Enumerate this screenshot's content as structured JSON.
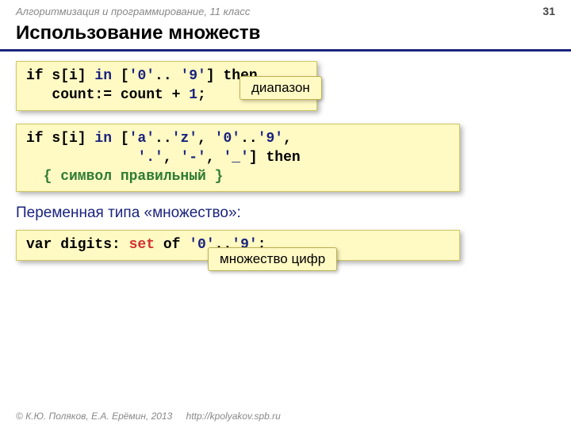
{
  "header": {
    "course": "Алгоритмизация и программирование, 11 класс",
    "page": "31"
  },
  "title": "Использование множеств",
  "code1": {
    "line1": {
      "t1": "if s[i] ",
      "in": "in",
      "t2": " [",
      "s1": "'0'",
      "t3": ".. ",
      "s2": "'9'",
      "t4": "] ",
      "then": "then"
    },
    "line2": {
      "t1": "   count:= count + ",
      "n": "1",
      "t2": ";"
    }
  },
  "callout1": "диапазон",
  "code2": {
    "line1": {
      "t1": "if s[i] ",
      "in": "in",
      "t2": " [",
      "s1": "'a'",
      "t3": "..",
      "s2": "'z'",
      "t4": ", ",
      "s3": "'0'",
      "t5": "..",
      "s4": "'9'",
      "t6": ","
    },
    "line2": {
      "pad": "             ",
      "s1": "'.'",
      "t1": ", ",
      "s2": "'-'",
      "t2": ", ",
      "s3": "'_'",
      "t3": "] ",
      "then": "then"
    },
    "line3": "  { символ правильный }"
  },
  "subtitle": "Переменная типа «множество»:",
  "code3": {
    "t1": "var digits: ",
    "set": "set",
    "t2": " of ",
    "s1": "'0'",
    "t3": "..",
    "s2": "'9'",
    "t4": ";"
  },
  "callout2": "множество цифр",
  "footer": {
    "copy": "© К.Ю. Поляков, Е.А. Ерёмин, 2013",
    "url": "http://kpolyakov.spb.ru"
  }
}
